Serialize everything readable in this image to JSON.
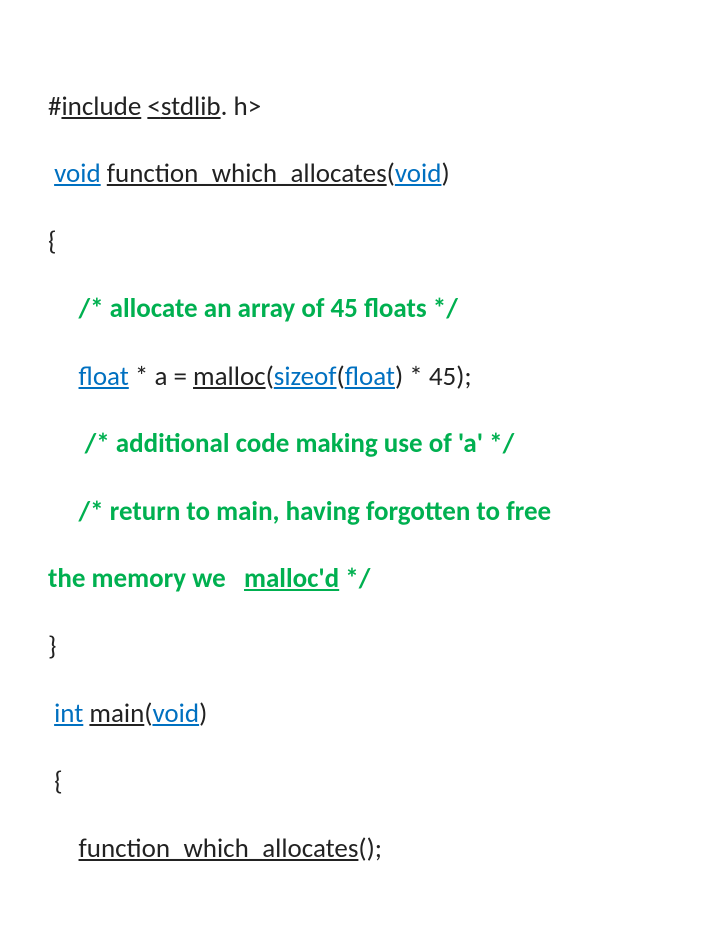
{
  "code": {
    "line1": {
      "hash": "#",
      "include": "include",
      "sp1": " ",
      "lt": "<",
      "stdlib": "stdlib",
      "dot": ". ",
      "h": "h",
      "gt": ">"
    },
    "line2": {
      "sp": " ",
      "voidkw": "void",
      "sp2": " ",
      "fn": "function_which_allocates",
      "lp": "(",
      "voidarg": "void",
      "rp": ")"
    },
    "line3": "{",
    "line4": {
      "indent": "     ",
      "comment": "/* allocate an array of 45 floats */"
    },
    "line5": {
      "indent": "     ",
      "floatkw": "float",
      "rest": " * a = ",
      "malloc": "malloc",
      "lp": "(",
      "sizeof": "sizeof",
      "lp2": "(",
      "float2": "float",
      "rp2": ") * 45);"
    },
    "line6": {
      "indent": "      ",
      "comment": "/* additional code making use of 'a' */"
    },
    "line7a": {
      "indent": "     ",
      "commentA": "/* return to main, having forgotten to free "
    },
    "line7b": {
      "text": "the memory we   ",
      "malloc": "malloc'd",
      "end": " */"
    },
    "line8": "}",
    "line9": {
      "sp": " ",
      "intkw": "int",
      "sp2": " ",
      "main": "main",
      "lp": "(",
      "voidarg": "void",
      "rparen": ")"
    },
    "line10": " {",
    "line11": {
      "indent": "     ",
      "call": "function_which_allocates",
      "end": "();"
    }
  }
}
